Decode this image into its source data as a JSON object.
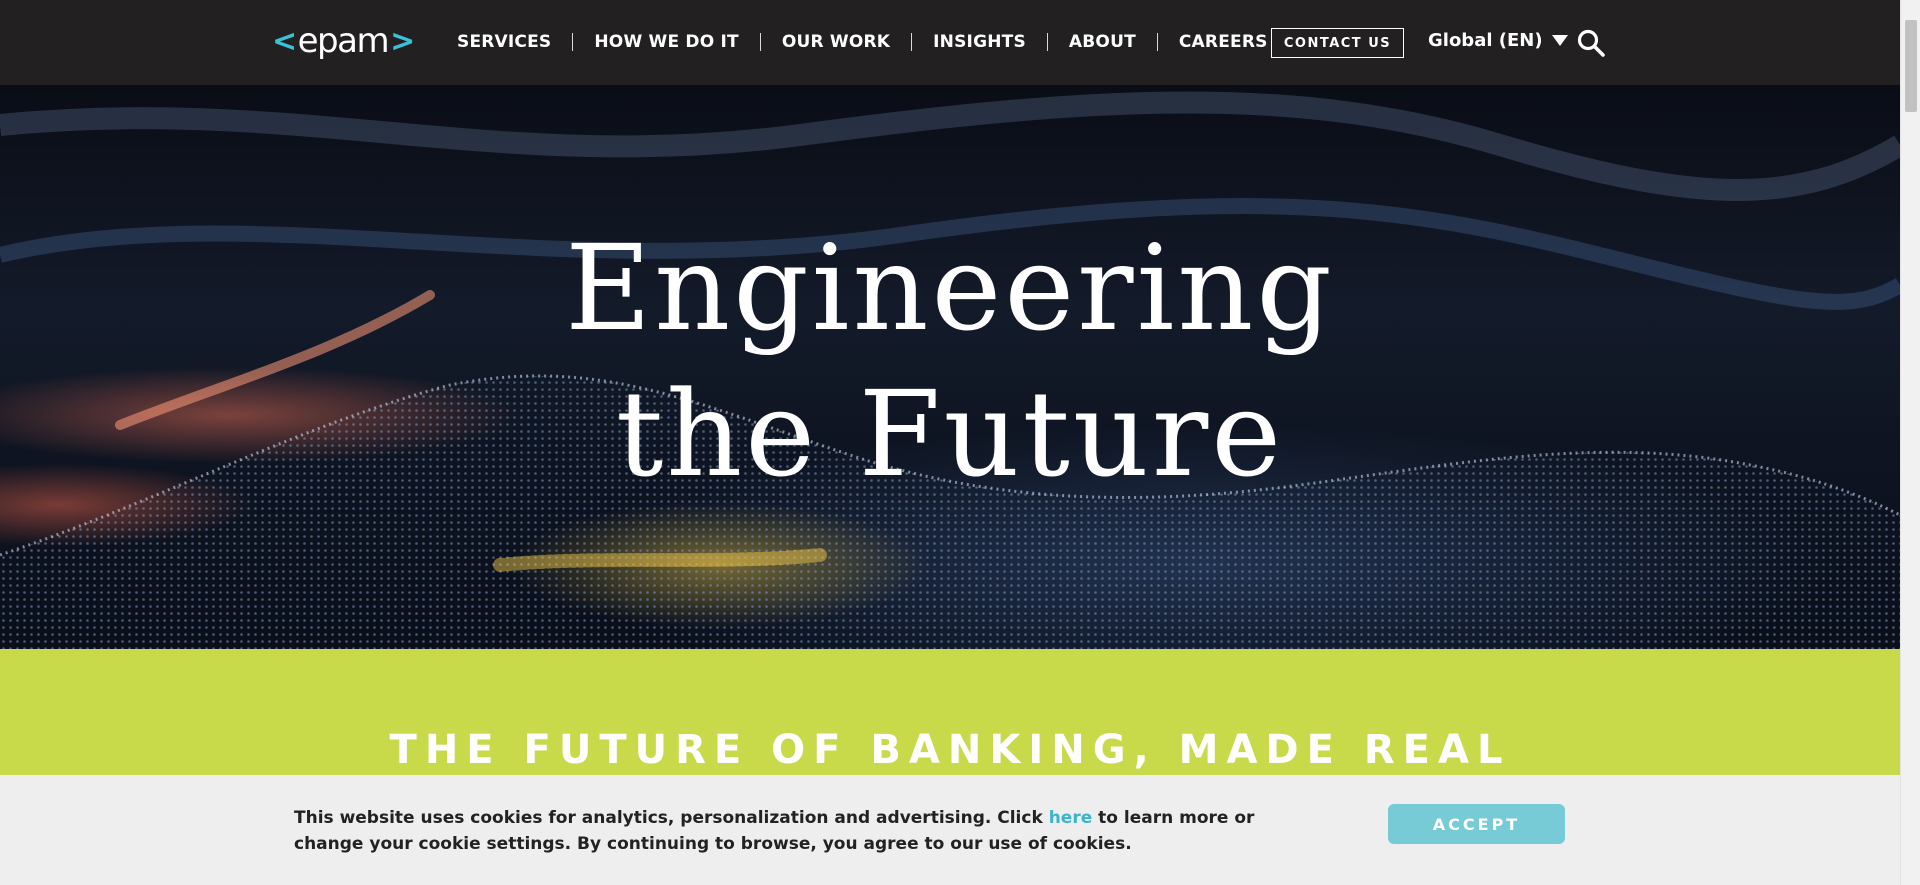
{
  "header": {
    "logo_text": "epam",
    "logo_left": "<",
    "logo_right": ">",
    "nav": [
      {
        "label": "SERVICES"
      },
      {
        "label": "HOW WE DO IT"
      },
      {
        "label": "OUR WORK"
      },
      {
        "label": "INSIGHTS"
      },
      {
        "label": "ABOUT"
      },
      {
        "label": "CAREERS"
      }
    ],
    "contact_label": "CONTACT US",
    "language_label": "Global (EN)",
    "search_icon": "search-icon"
  },
  "hero": {
    "title_line1": "Engineering",
    "title_line2": "the Future"
  },
  "band": {
    "title": "THE FUTURE OF BANKING, MADE REAL"
  },
  "cookie": {
    "text_before": "This website uses cookies for analytics, personalization and advertising. Click ",
    "link_text": "here",
    "text_after": " to learn more or change your cookie settings. By continuing to browse, you agree to our use of cookies.",
    "accept_label": "ACCEPT"
  },
  "colors": {
    "header_bg": "#222020",
    "accent_cyan": "#39c2d7",
    "band_green": "#c8da4a",
    "accept_button": "#76cbd7",
    "cookie_bg": "#eeeeee"
  }
}
